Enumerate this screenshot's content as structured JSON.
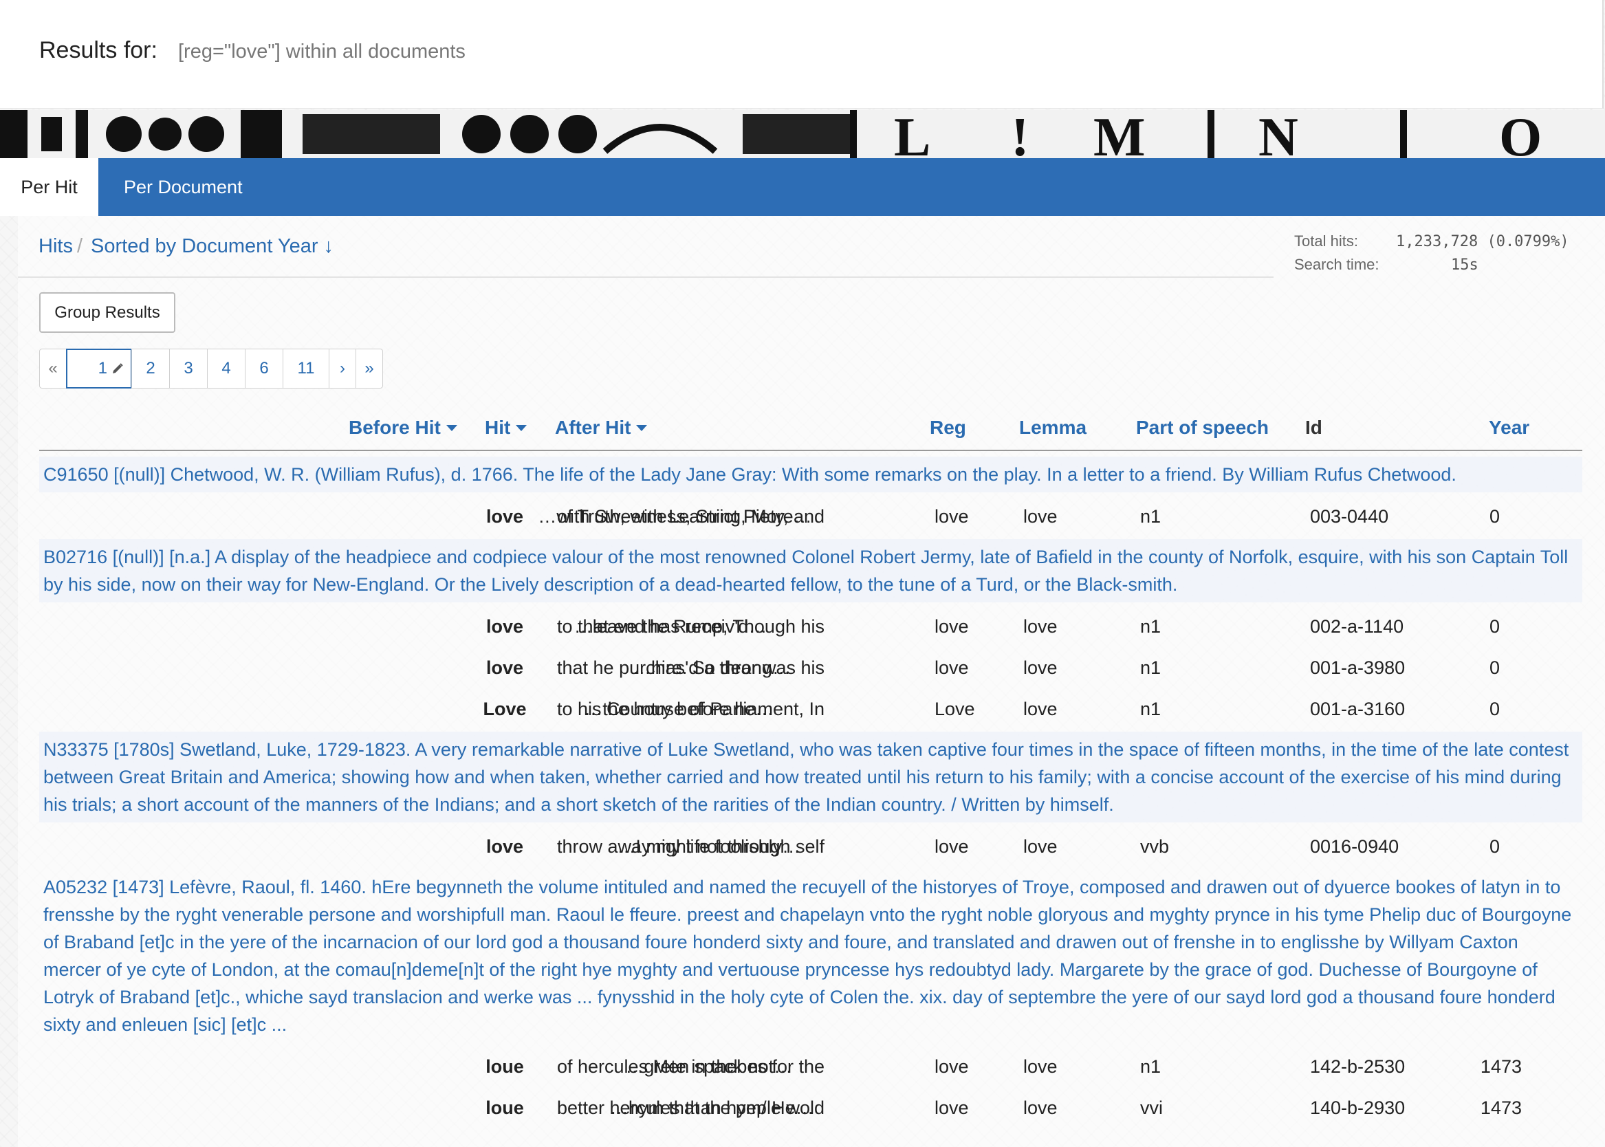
{
  "header": {
    "results_for_label": "Results for:",
    "query": "[reg=\"love\"] within all documents"
  },
  "tabs": [
    {
      "label": "Per Hit",
      "active": true
    },
    {
      "label": "Per Document",
      "active": false
    }
  ],
  "breadcrumb": {
    "root": "Hits",
    "separator": "/",
    "current": "Sorted by Document Year ↓"
  },
  "stats": {
    "total_hits_label": "Total hits:",
    "total_hits_value": "1,233,728 (0.0799%)",
    "search_time_label": "Search time:",
    "search_time_value": "15s"
  },
  "group_button": "Group Results",
  "pagination": {
    "first": "«",
    "current": "1",
    "pages": [
      "2",
      "3",
      "4",
      "6",
      "11"
    ],
    "next": "›",
    "last": "»"
  },
  "columns": {
    "before_hit": "Before Hit",
    "hit": "Hit",
    "after_hit": "After Hit",
    "reg": "Reg",
    "lemma": "Lemma",
    "pos": "Part of speech",
    "id": "Id",
    "year": "Year"
  },
  "documents": [
    {
      "title": "C91650 [(null)] Chetwood, W. R. (William Rufus), d. 1766. The life of the Lady Jane Gray: With some remarks on the play. In a letter to a friend. By William Rufus Chetwood.",
      "hits": [
        {
          "before": "…with Sweetness, Strict Piety, and",
          "hit": "love",
          "after": "of Truth, with Learning, More…",
          "reg": "love",
          "lemma": "love",
          "pos": "n1",
          "id": "003-0440",
          "year": "0"
        }
      ]
    },
    {
      "title": "B02716 [(null)] [n.a.] A display of the headpiece and codpiece valour of the most renowned Colonel Robert Jermy, late of Bafield in the county of Norfolk, esquire, with his son Captain Toll by his side, now on their way for New-England. Or the Lively description of a dead-hearted fellow, to the tune of a Turd, or the Black-smith.",
      "hits": [
        {
          "before": "…leave the Rump, Though his",
          "hit": "love",
          "after": "to that end has receiv'd…",
          "reg": "love",
          "lemma": "love",
          "pos": "n1",
          "id": "002-a-1140",
          "year": "0"
        },
        {
          "before": "…hire. So dear was his",
          "hit": "love",
          "after": "that he purchas'd a throng…",
          "reg": "love",
          "lemma": "love",
          "pos": "n1",
          "id": "001-a-3980",
          "year": "0"
        },
        {
          "before": "…the house of Parliament, In",
          "hit": "Love",
          "after": "to his Country before he…",
          "reg": "Love",
          "lemma": "love",
          "pos": "n1",
          "id": "001-a-3160",
          "year": "0"
        }
      ]
    },
    {
      "title": "N33375 [1780s] Swetland, Luke, 1729-1823. A very remarkable narrative of Luke Swetland, who was taken captive four times in the space of fifteen months, in the time of the late contest between Great Britain and America; showing how and when taken, whether carried and how treated until his return to his family; with a concise account of the exercise of his mind during his trials; a short account of the manners of the Indians; and a short sketch of the rarities of the Indian country. / Written by himself.",
      "hits": [
        {
          "before": "…I might not through self",
          "hit": "love",
          "after": "throw away my life foolishly…",
          "reg": "love",
          "lemma": "love",
          "pos": "vvb",
          "id": "0016-0940",
          "year": "0"
        }
      ]
    },
    {
      "title": "A05232 [1473] Lefèvre, Raoul, fl. 1460. hEre begynneth the volume intituled and named the recuyell of the historyes of Troye, composed and drawen out of dyuerce bookes of latyn in to frensshe by the ryght venerable persone and worshipfull man. Raoul le ffeure. preest and chapelayn vnto the ryght noble gloryous and myghty prynce in his tyme Phelip duc of Bourgoyne of Braband [et]c in the yere of the incarnacion of our lord god a thousand foure honderd sixty and foure, and translated and drawen out of frenshe in to englisshe by Willyam Caxton mercer of ye cyte of London, at the comau[n]deme[n]t of the right hye myghty and vertuouse pryncesse hys redoubtyd lady. Margarete by the grace of god. Duchesse of Bourgoyne of Lotryk of Braband [et]c., whiche sayd translacion and werke was ... fynysshid in the holy cyte of Colen the. xix. day of septembre the yere of our sayd lord god a thousand foure honderd sixty and enleuen [sic] [et]c ...",
      "hits": [
        {
          "before": "…grete in thebes for the",
          "hit": "loue",
          "after": "of hercules Men spack not…",
          "reg": "love",
          "lemma": "love",
          "pos": "n1",
          "id": "142-b-2530",
          "year": "1473"
        },
        {
          "before": "…hym that the peple wold",
          "hit": "loue",
          "after": "better hercules than hym/ He…",
          "reg": "love",
          "lemma": "love",
          "pos": "vvi",
          "id": "140-b-2930",
          "year": "1473"
        }
      ]
    }
  ],
  "colors": {
    "link": "#2a6bb0",
    "tabbar": "#2d6db5",
    "doc_row_bg": "#ebf0fa"
  },
  "icons": {
    "pencil": "pencil-icon",
    "caret": "caret-down-icon"
  }
}
